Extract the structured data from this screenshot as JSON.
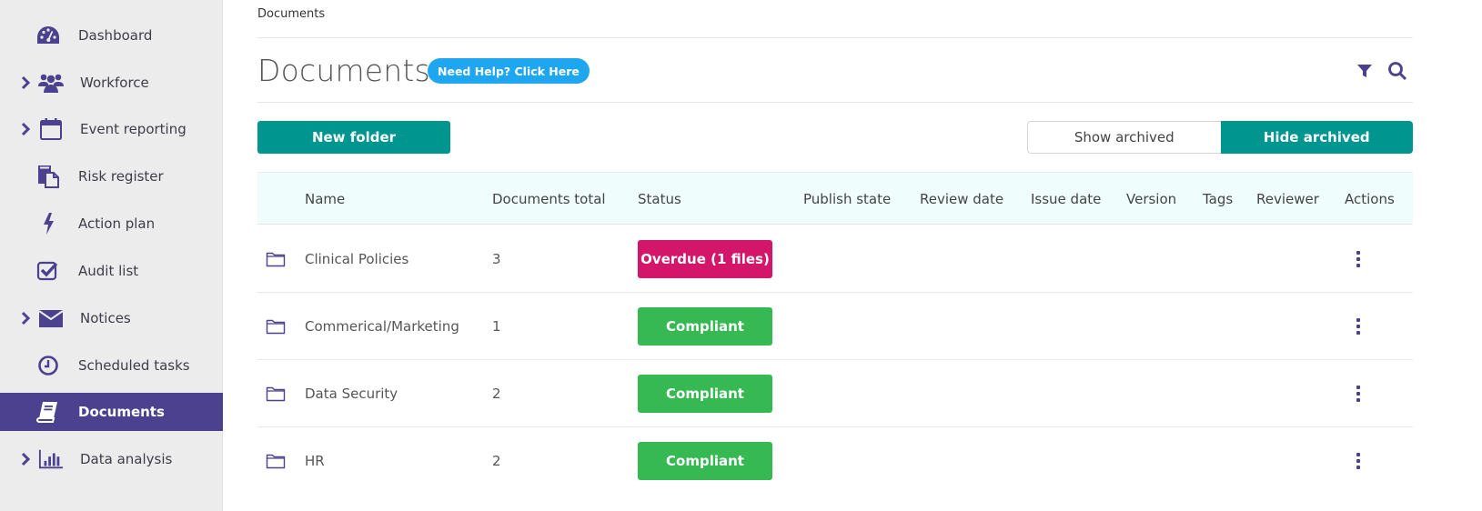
{
  "sidebar": {
    "items": [
      {
        "label": "Dashboard",
        "icon": "dashboard-gauge-icon",
        "has_children": false,
        "active": false
      },
      {
        "label": "Workforce",
        "icon": "users-icon",
        "has_children": true,
        "active": false
      },
      {
        "label": "Event reporting",
        "icon": "calendar-icon",
        "has_children": true,
        "active": false
      },
      {
        "label": "Risk register",
        "icon": "copy-document-icon",
        "has_children": false,
        "active": false
      },
      {
        "label": "Action plan",
        "icon": "lightning-bolt-icon",
        "has_children": false,
        "active": false
      },
      {
        "label": "Audit list",
        "icon": "checkbox-icon",
        "has_children": false,
        "active": false
      },
      {
        "label": "Notices",
        "icon": "envelope-icon",
        "has_children": true,
        "active": false
      },
      {
        "label": "Scheduled tasks",
        "icon": "clock-icon",
        "has_children": false,
        "active": false
      },
      {
        "label": "Documents",
        "icon": "book-icon",
        "has_children": false,
        "active": true
      },
      {
        "label": "Data analysis",
        "icon": "bar-chart-icon",
        "has_children": true,
        "active": false
      }
    ]
  },
  "header": {
    "breadcrumb": "Documents",
    "title": "Documents",
    "help_label": "Need Help? Click Here",
    "filter_icon": "filter-icon",
    "search_icon": "search-icon"
  },
  "toolbar": {
    "new_folder_label": "New folder",
    "show_archived_label": "Show archived",
    "hide_archived_label": "Hide archived",
    "selected": "Hide archived"
  },
  "table": {
    "columns": [
      "Name",
      "Documents total",
      "Status",
      "Publish state",
      "Review date",
      "Issue date",
      "Version",
      "Tags",
      "Reviewer",
      "Actions"
    ],
    "rows": [
      {
        "name": "Clinical Policies",
        "documents_total": "3",
        "status": "Overdue (1 files)",
        "status_type": "overdue"
      },
      {
        "name": "Commerical/Marketing",
        "documents_total": "1",
        "status": "Compliant",
        "status_type": "compliant"
      },
      {
        "name": "Data Security",
        "documents_total": "2",
        "status": "Compliant",
        "status_type": "compliant"
      },
      {
        "name": "HR",
        "documents_total": "2",
        "status": "Compliant",
        "status_type": "compliant"
      }
    ]
  },
  "colors": {
    "primary": "#4b418e",
    "teal": "#00968f",
    "help_blue": "#1ea6f0",
    "overdue": "#d4166a",
    "compliant": "#36b853",
    "header_bg": "#effdfd",
    "sidebar_bg": "#ececec"
  }
}
